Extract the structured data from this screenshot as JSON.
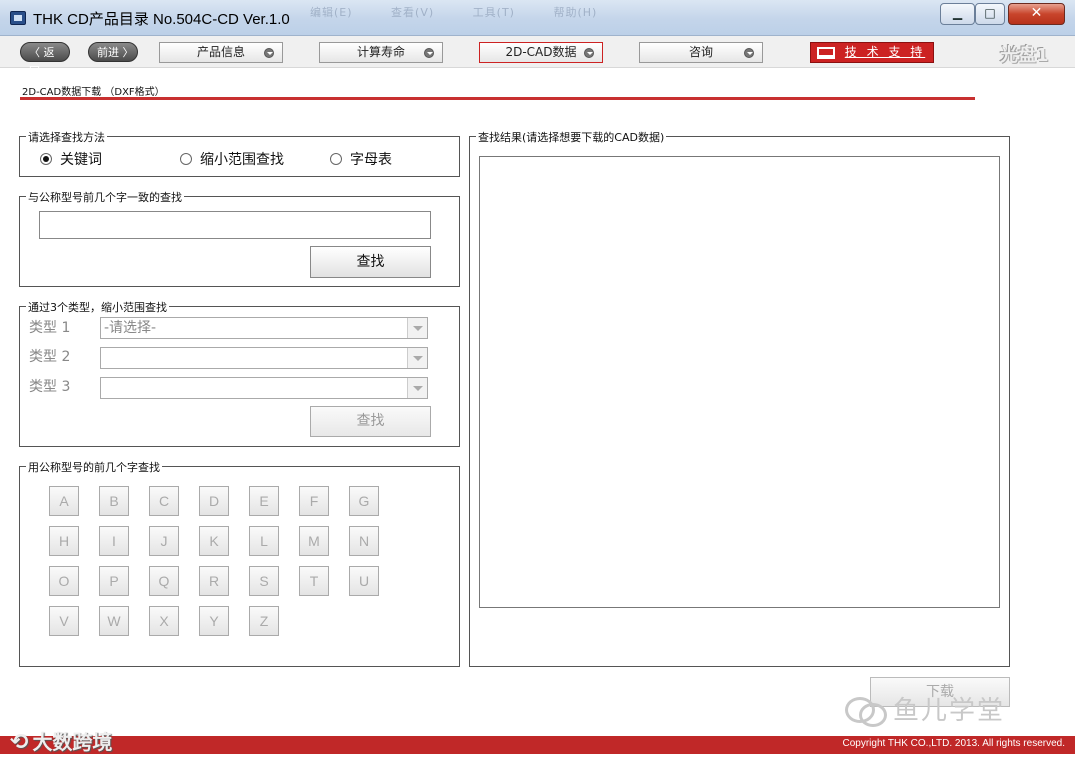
{
  "window": {
    "title": "THK CD产品目录 No.504C-CD Ver.1.0",
    "min_glyph": "▁",
    "max_glyph": "□",
    "close_glyph": "✕",
    "ghost_menu": [
      "编辑(E)",
      "查看(V)",
      "工具(T)",
      "帮助(H)"
    ]
  },
  "nav": {
    "back": "〈 返回",
    "forward": "前进 〉",
    "tabs": [
      "产品信息",
      "计算寿命",
      "2D-CAD数据",
      "咨询"
    ],
    "active_tab": "2D-CAD数据",
    "support": "技 术 支 持",
    "disc": "光盘1"
  },
  "header": {
    "section_title": "2D-CAD数据下载 （DXF格式）",
    "accent_color": "#c83030"
  },
  "search_method": {
    "legend": "请选择查找方法",
    "options": [
      "关键词",
      "缩小范围查找",
      "字母表"
    ],
    "selected": "关键词"
  },
  "keyword_search": {
    "legend": "与公称型号前几个字一致的查找",
    "input_value": "",
    "button": "查找"
  },
  "narrow_search": {
    "legend": "通过3个类型，缩小范围查找",
    "rows": [
      {
        "label": "类型 1",
        "value": "-请选择-"
      },
      {
        "label": "类型 2",
        "value": ""
      },
      {
        "label": "类型 3",
        "value": ""
      }
    ],
    "button": "查找"
  },
  "alphabet_search": {
    "legend": "用公称型号的前几个字查找",
    "letters": [
      "A",
      "B",
      "C",
      "D",
      "E",
      "F",
      "G",
      "H",
      "I",
      "J",
      "K",
      "L",
      "M",
      "N",
      "O",
      "P",
      "Q",
      "R",
      "S",
      "T",
      "U",
      "V",
      "W",
      "X",
      "Y",
      "Z"
    ]
  },
  "results": {
    "legend": "查找结果(请选择想要下载的CAD数据)"
  },
  "download": {
    "button": "下载"
  },
  "watermarks": {
    "right": "鱼儿学堂",
    "left": "大数跨境"
  },
  "footer": {
    "copyright": "Copyright THK CO.,LTD. 2013. All rights reserved.",
    "color": "#c02828"
  }
}
